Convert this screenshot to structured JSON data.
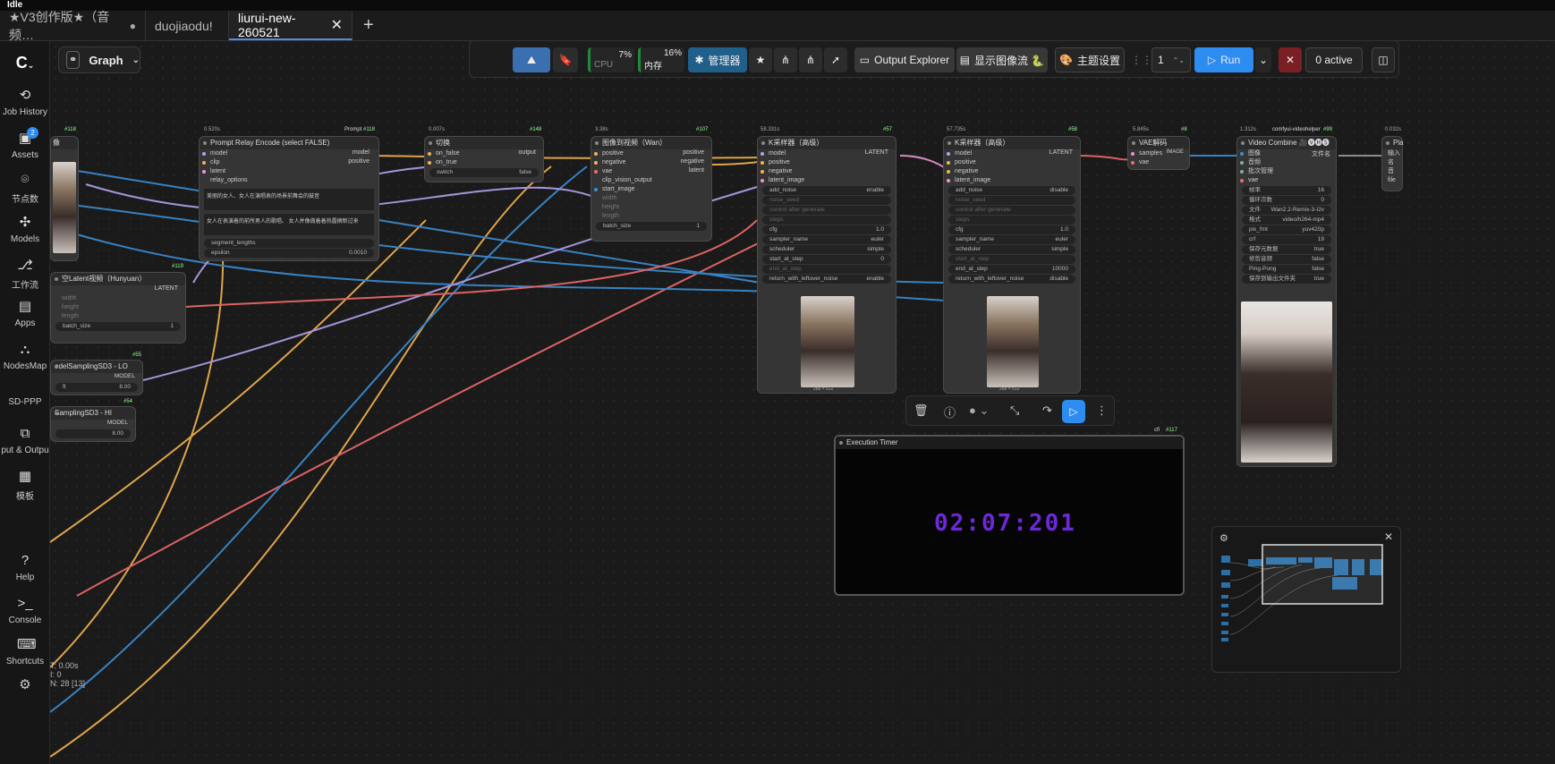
{
  "titlebar": {
    "status": "Idle"
  },
  "tabs": [
    {
      "label": "★V3创作版★（音频…",
      "marker": "●"
    },
    {
      "label": "duojiaodu!",
      "marker": ""
    },
    {
      "label": "liurui-new-260521",
      "marker": "✕"
    }
  ],
  "tab_add": "+",
  "sidebar": {
    "items": [
      {
        "label": "Job History",
        "icon": "history-icon"
      },
      {
        "label": "Assets",
        "icon": "assets-icon",
        "badge": "2"
      },
      {
        "label": "节点数",
        "icon": "node-library-icon"
      },
      {
        "label": "Models",
        "icon": "models-icon"
      },
      {
        "label": "工作流",
        "icon": "workflow-icon"
      },
      {
        "label": "Apps",
        "icon": "apps-icon"
      },
      {
        "label": "NodesMap",
        "icon": "nodesmap-icon"
      },
      {
        "label": "SD-PPP",
        "icon": ""
      },
      {
        "label": "put & Outpu",
        "icon": "image-io-icon"
      },
      {
        "label": "模板",
        "icon": "template-icon"
      },
      {
        "label": "Help",
        "icon": "help-icon"
      },
      {
        "label": "Console",
        "icon": "console-icon"
      },
      {
        "label": "Shortcuts",
        "icon": "keyboard-icon"
      }
    ]
  },
  "graph_button": {
    "label": "Graph"
  },
  "toolbar": {
    "cpu_label": "CPU",
    "cpu_value": "7%",
    "mem_label": "内存",
    "mem_value": "16%",
    "manager_label": "管理器",
    "output_explorer_label": "Output Explorer",
    "show_image_stream_label": "显示图像流 🐍",
    "theme_label": "主题设置",
    "queue_count": "1",
    "run_label": "Run",
    "active_label": "0 active"
  },
  "nodes": {
    "prompt_relay": {
      "title": "Prompt Relay Encode (select FALSE)",
      "id": "#118",
      "time": "0.520s",
      "tag": "Prompt",
      "inputs": [
        "model",
        "clip",
        "latent",
        "relay_options"
      ],
      "outputs": [
        "model",
        "positive"
      ],
      "text1": "美丽的女人、女人在演唱表的场景前舞会的鼓音",
      "text2": "女人在表演着的前所男人的歌唱、 女人并像做着着热露摘新过来",
      "w_segment": "segment_lengths",
      "w_epsilon_label": "epsilon",
      "w_epsilon_val": "0.0010"
    },
    "switch": {
      "title": "切换",
      "id": "#148",
      "time": "0.007s",
      "inputs": [
        "on_false",
        "on_true"
      ],
      "outputs": [
        "output"
      ],
      "w_label": "switch",
      "w_val": "false"
    },
    "img2video": {
      "title": "图像到视频（Wan）",
      "id": "#107",
      "time": "3.38s",
      "inputs": [
        "positive",
        "negative",
        "vae",
        "clip_vision_output",
        "start_image"
      ],
      "outputs": [
        "positive",
        "negative",
        "latent"
      ],
      "w": [
        "width",
        "height",
        "length"
      ],
      "batch_label": "batch_size",
      "batch_val": "1"
    },
    "ksampler1": {
      "title": "K采样器（高级）",
      "id": "#57",
      "time": "58.331s",
      "inputs": [
        "model",
        "positive",
        "negative",
        "latent_image"
      ],
      "outputs": [
        "LATENT"
      ],
      "widgets": [
        [
          "add_noise",
          "enable"
        ],
        [
          "noise_seed",
          ""
        ],
        [
          "control after generate",
          ""
        ],
        [
          "steps",
          ""
        ],
        [
          "cfg",
          "1.0"
        ],
        [
          "sampler_name",
          "euler"
        ],
        [
          "scheduler",
          "simple"
        ],
        [
          "start_at_step",
          "0"
        ],
        [
          "end_at_step",
          ""
        ],
        [
          "return_with_leftover_noise",
          "enable"
        ]
      ],
      "size_label": "288 × 512"
    },
    "ksampler2": {
      "title": "K采样器（高级）",
      "id": "#58",
      "time": "57.735s",
      "inputs": [
        "model",
        "positive",
        "negative",
        "latent_image"
      ],
      "outputs": [
        "LATENT"
      ],
      "widgets": [
        [
          "add_noise",
          "disable"
        ],
        [
          "noise_seed",
          ""
        ],
        [
          "control after generate",
          ""
        ],
        [
          "steps",
          ""
        ],
        [
          "cfg",
          "1.0"
        ],
        [
          "sampler_name",
          "euler"
        ],
        [
          "scheduler",
          "simple"
        ],
        [
          "start_at_step",
          ""
        ],
        [
          "end_at_step",
          "10000"
        ],
        [
          "return_with_leftover_noise",
          "disable"
        ]
      ],
      "size_label": "288 × 512"
    },
    "vae_decode": {
      "title": "VAE解码",
      "id": "#8",
      "time": "5.845s",
      "inputs": [
        "samples",
        "vae"
      ],
      "outputs": [
        "IMAGE"
      ]
    },
    "video_combine": {
      "title": "Video Combine 🎥🅥🅗🅢",
      "id": "#99",
      "time": "1.312s",
      "tag": "comfyui-videohelper",
      "inputs": [
        "图像",
        "音频",
        "批次管理",
        "vae"
      ],
      "outputs": [
        "文件名"
      ],
      "widgets": [
        [
          "帧率",
          "16"
        ],
        [
          "循环次数",
          "0"
        ],
        [
          "文件",
          "Wan2.2-Remix-3-I2v"
        ],
        [
          "格式",
          "video/h264-mp4"
        ],
        [
          "pix_fmt",
          "yuv420p"
        ],
        [
          "crf",
          "19"
        ],
        [
          "保存元数据",
          "true"
        ],
        [
          "修剪音频",
          "false"
        ],
        [
          "Ping-Pong",
          "false"
        ],
        [
          "保存到输出文件夹",
          "true"
        ]
      ]
    },
    "empty_latent": {
      "title": "空Latent视频（Hunyuan）",
      "id": "#119",
      "outputs": [
        "LATENT"
      ],
      "w": [
        "width",
        "height",
        "length"
      ],
      "batch_label": "batch_size",
      "batch_val": "1"
    },
    "model_lo": {
      "title": "odelSamplingSD3 - LO",
      "id": "#55",
      "out": "MODEL",
      "val": "8.00",
      "wlabel": "ft"
    },
    "model_hi": {
      "title": "SamplingSD3 - HI",
      "id": "#54",
      "out": "MODEL",
      "val": "8.00"
    },
    "partial_left": {
      "title": "像",
      "id": "#118",
      "foot": "296 × 804"
    },
    "partial_right": {
      "title": "Pla",
      "time": "0.032s",
      "rows": [
        "输入",
        "名",
        "音",
        "file"
      ]
    }
  },
  "timer": {
    "title": "Execution Timer",
    "id": "#117",
    "tag": "cfl",
    "display": "02:07:201"
  },
  "stats": {
    "line1": "T: 0.00s",
    "line2": "I: 0",
    "line3": "N: 28 [13]"
  }
}
